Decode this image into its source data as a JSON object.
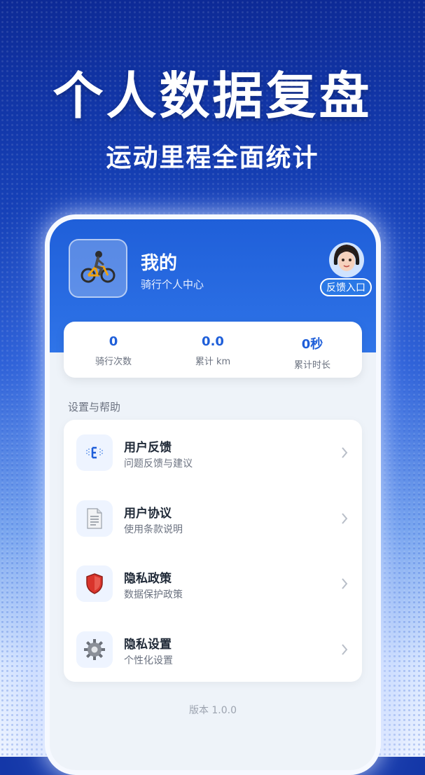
{
  "banner": {
    "headline": "个人数据复盘",
    "subheadline": "运动里程全面统计"
  },
  "profile": {
    "avatar_icon": "cyclist-icon",
    "title": "我的",
    "subtitle": "骑行个人中心",
    "feedback_button": {
      "icon": "support-agent-icon",
      "label": "反馈入口"
    }
  },
  "stats": [
    {
      "value": "0",
      "label": "骑行次数"
    },
    {
      "value": "0.0",
      "label": "累计 km"
    },
    {
      "value": "0秒",
      "label": "累计时长"
    }
  ],
  "section": {
    "title": "设置与帮助"
  },
  "menu": [
    {
      "icon": "feedback-icon",
      "label": "用户反馈",
      "desc": "问题反馈与建议"
    },
    {
      "icon": "document-icon",
      "label": "用户协议",
      "desc": "使用条款说明"
    },
    {
      "icon": "shield-icon",
      "label": "隐私政策",
      "desc": "数据保护政策"
    },
    {
      "icon": "gear-icon",
      "label": "隐私设置",
      "desc": "个性化设置"
    }
  ],
  "footer": {
    "version": "版本 1.0.0"
  },
  "colors": {
    "accent": "#1f5fd9",
    "background_top": "#0d2a96",
    "card": "#ffffff"
  }
}
